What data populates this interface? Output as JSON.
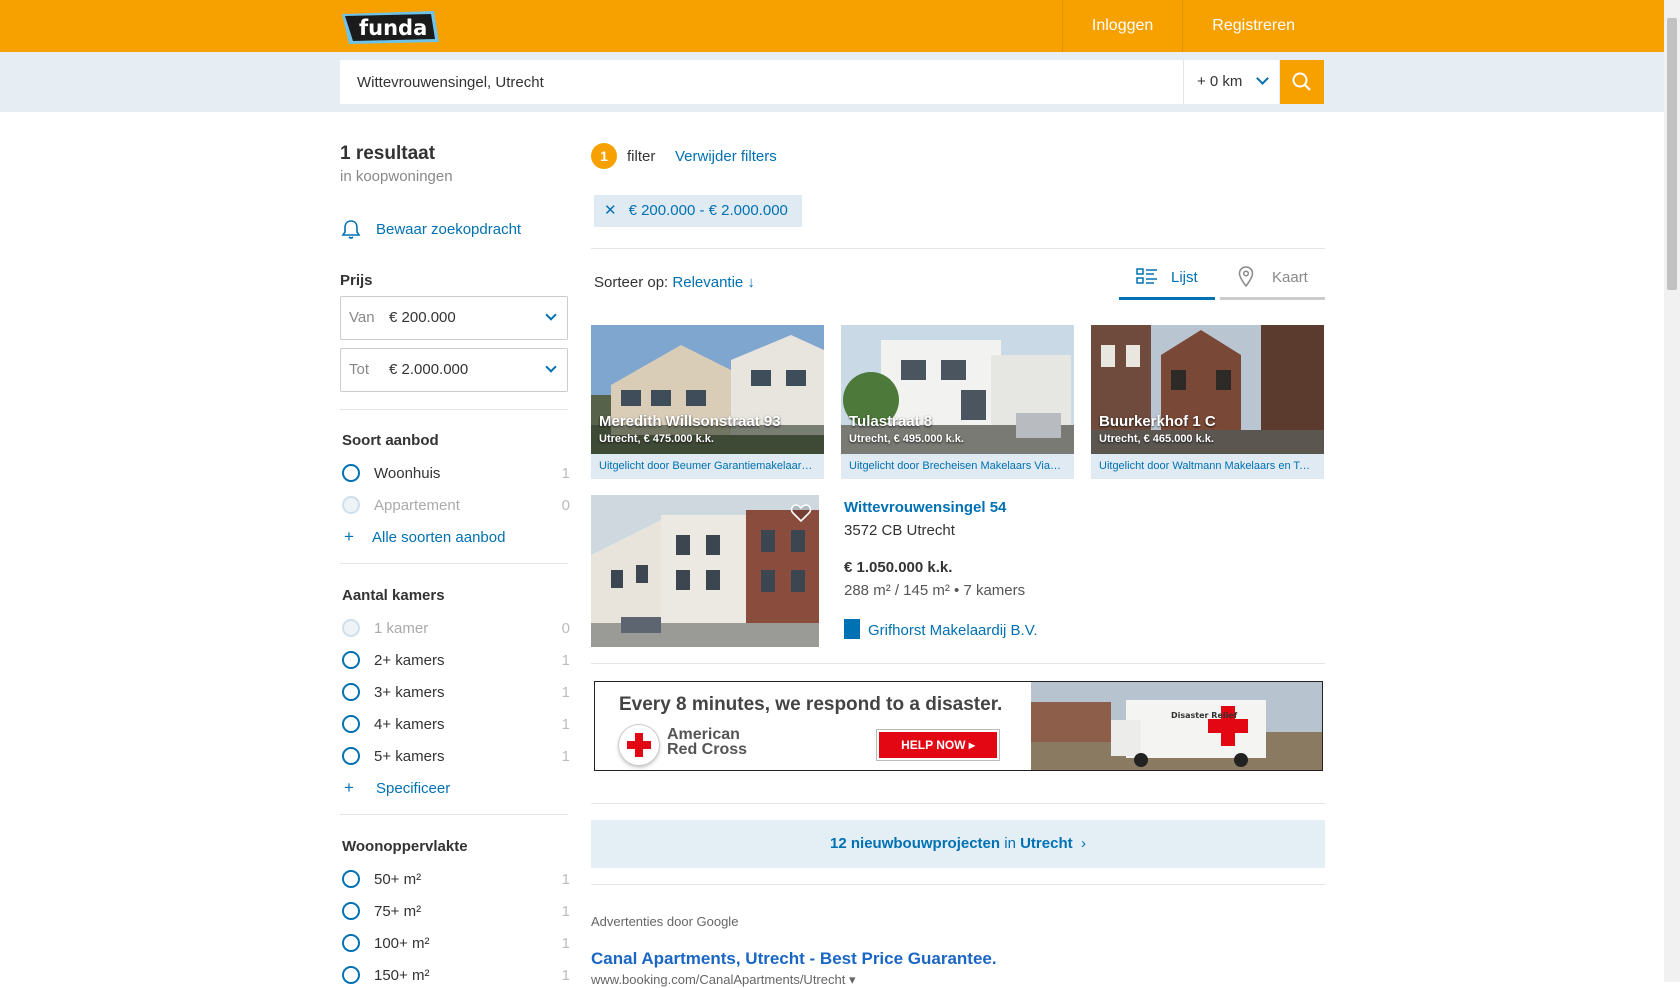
{
  "header": {
    "logo": "funda",
    "login": "Inloggen",
    "register": "Registreren"
  },
  "search": {
    "value": "Wittevrouwensingel, Utrecht",
    "radius": "+ 0 km"
  },
  "sidebar": {
    "results_title": "1 resultaat",
    "results_sub": "in koopwoningen",
    "save_search": "Bewaar zoekopdracht",
    "price": {
      "heading": "Prijs",
      "from_label": "Van",
      "from_value": "€ 200.000",
      "to_label": "Tot",
      "to_value": "€ 2.000.000"
    },
    "offer_type": {
      "heading": "Soort aanbod",
      "options": [
        {
          "label": "Woonhuis",
          "count": "1"
        },
        {
          "label": "Appartement",
          "count": "0"
        }
      ],
      "more": "Alle soorten aanbod"
    },
    "rooms": {
      "heading": "Aantal kamers",
      "options": [
        {
          "label": "1 kamer",
          "count": "0"
        },
        {
          "label": "2+ kamers",
          "count": "1"
        },
        {
          "label": "3+ kamers",
          "count": "1"
        },
        {
          "label": "4+ kamers",
          "count": "1"
        },
        {
          "label": "5+ kamers",
          "count": "1"
        }
      ],
      "more": "Specificeer"
    },
    "area": {
      "heading": "Woonoppervlakte",
      "options": [
        {
          "label": "50+ m²",
          "count": "1"
        },
        {
          "label": "75+ m²",
          "count": "1"
        },
        {
          "label": "100+ m²",
          "count": "1"
        },
        {
          "label": "150+ m²",
          "count": "1"
        }
      ]
    }
  },
  "filters": {
    "count": "1",
    "label": "filter",
    "remove": "Verwijder filters",
    "chip": "€ 200.000 - € 2.000.000"
  },
  "sort": {
    "label": "Sorteer op:",
    "value": "Relevantie ↓"
  },
  "view": {
    "list": "Lijst",
    "map": "Kaart"
  },
  "featured": [
    {
      "title": "Meredith Willsonstraat 93",
      "sub": "Utrecht, € 475.000 k.k.",
      "by": "Uitgelicht door Beumer Garantiemakelaars Utrecht"
    },
    {
      "title": "Tulastraat 8",
      "sub": "Utrecht, € 495.000 k.k.",
      "by": "Uitgelicht door Brecheisen Makelaars Vianen"
    },
    {
      "title": "Buurkerkhof 1 C",
      "sub": "Utrecht, € 465.000 k.k.",
      "by": "Uitgelicht door Waltmann Makelaars en Taxateurs"
    }
  ],
  "listing": {
    "address": "Wittevrouwensingel 54",
    "postcode": "3572 CB Utrecht",
    "price": "€ 1.050.000 k.k.",
    "specs": "288 m² / 145 m² •  7 kamers",
    "broker": "Grifhorst Makelaardij B.V."
  },
  "ad": {
    "headline": "Every 8 minutes, we respond to a disaster.",
    "org_line1": "American",
    "org_line2": "Red Cross",
    "button": "HELP NOW  ▸",
    "truck_text": "Disaster Relief"
  },
  "newbuild": {
    "count_text": "12 nieuwbouwprojecten",
    "in": "in",
    "city": "Utrecht"
  },
  "google_ads": {
    "label": "Advertenties door Google",
    "title": "Canal Apartments, Utrecht - Best Price Guarantee.",
    "url": "www.booking.com/CanalApartments/Utrecht ▾"
  },
  "colors": {
    "brand_orange": "#f7a100",
    "link_blue": "#0071b3",
    "panel_blue": "#e4eef5"
  }
}
